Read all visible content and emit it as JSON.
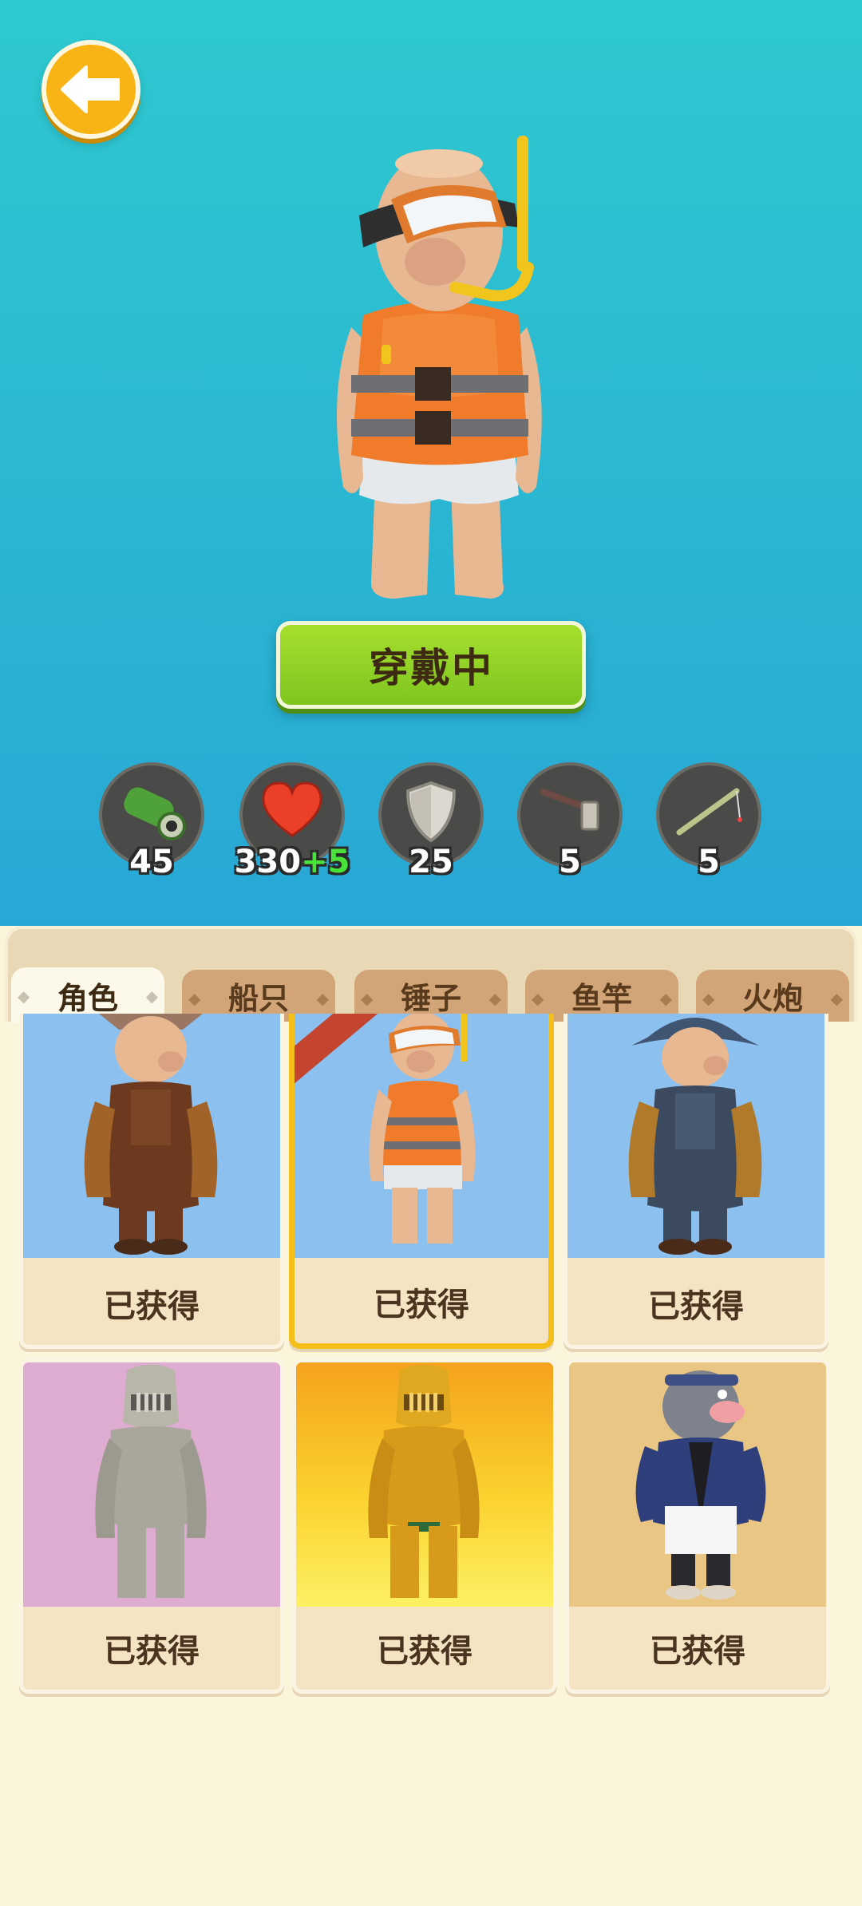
{
  "header": {
    "back_icon": "arrow-left-icon"
  },
  "hero": {
    "wear_label": "穿戴中"
  },
  "stats": [
    {
      "icon": "cannon-icon",
      "value": "45",
      "bonus": ""
    },
    {
      "icon": "heart-icon",
      "value": "330",
      "bonus": "+5"
    },
    {
      "icon": "shield-icon",
      "value": "25",
      "bonus": ""
    },
    {
      "icon": "hammer-icon",
      "value": "5",
      "bonus": ""
    },
    {
      "icon": "fishing-rod-icon",
      "value": "5",
      "bonus": ""
    }
  ],
  "tabs": [
    {
      "label": "角色",
      "active": true
    },
    {
      "label": "船只",
      "active": false
    },
    {
      "label": "锤子",
      "active": false
    },
    {
      "label": "鱼竿",
      "active": false
    },
    {
      "label": "火炮",
      "active": false
    }
  ],
  "items": [
    {
      "label": "已获得",
      "character": "farmer-brown-overalls"
    },
    {
      "label": "已获得",
      "character": "snorkel-lifevest",
      "selected": true
    },
    {
      "label": "已获得",
      "character": "farmer-blue-overalls"
    },
    {
      "label": "已获得",
      "character": "silver-knight"
    },
    {
      "label": "已获得",
      "character": "gold-knight"
    },
    {
      "label": "已获得",
      "character": "fish-head-chef"
    }
  ],
  "colors": {
    "accent_yellow": "#f7b414",
    "button_green": "#8ccc24",
    "tab_brown": "#d2a578",
    "selected_border": "#f5bf19"
  }
}
